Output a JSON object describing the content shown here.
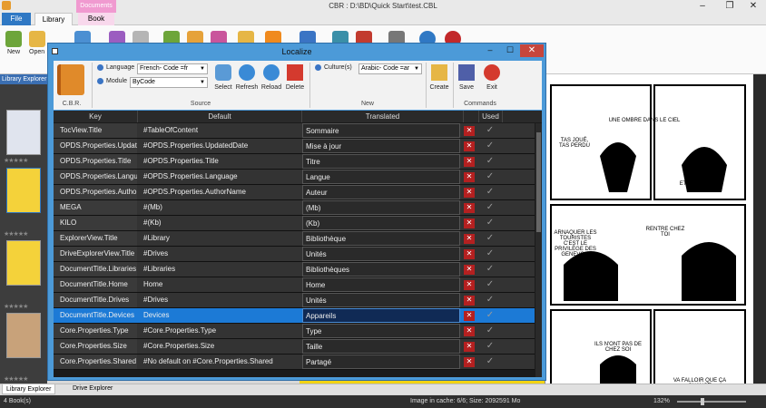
{
  "window": {
    "title": "CBR : D:\\BD\\Quick Start\\test.CBL",
    "context_tab": "Documents"
  },
  "ribbon": {
    "tabs": [
      "File",
      "Library",
      "Book"
    ],
    "buttons": [
      "New",
      "Open"
    ]
  },
  "library_explorer": {
    "title": "Library Explorer"
  },
  "dialog": {
    "title": "Localize",
    "cbr_group_label": "C.B.R.",
    "language_label": "Language",
    "language_value": "French- Code =fr",
    "module_label": "Module",
    "module_value": "ByCode",
    "select_label": "Select",
    "refresh_label": "Refresh",
    "reload_label": "Reload",
    "delete_label": "Delete",
    "source_group_label": "Source",
    "culture_label": "Culture(s)",
    "culture_value": "Arabic- Code =ar",
    "new_group_label": "New",
    "create_label": "Create",
    "save_label": "Save",
    "exit_label": "Exit",
    "commands_group_label": "Commands",
    "columns": [
      "Key",
      "Default",
      "Translated",
      "Used"
    ],
    "rows": [
      {
        "key": "TocView.Title",
        "default": "#TableOfContent",
        "translated": "Sommaire"
      },
      {
        "key": "OPDS.Properties.UpdatedDate",
        "default": "#OPDS.Properties.UpdatedDate",
        "translated": "Mise à jour"
      },
      {
        "key": "OPDS.Properties.Title",
        "default": "#OPDS.Properties.Title",
        "translated": "Titre"
      },
      {
        "key": "OPDS.Properties.Language",
        "default": "#OPDS.Properties.Language",
        "translated": "Langue"
      },
      {
        "key": "OPDS.Properties.AuthorName",
        "default": "#OPDS.Properties.AuthorName",
        "translated": "Auteur"
      },
      {
        "key": "MEGA",
        "default": "#(Mb)",
        "translated": "(Mb)"
      },
      {
        "key": "KILO",
        "default": "#(Kb)",
        "translated": "(Kb)"
      },
      {
        "key": "ExplorerView.Title",
        "default": "#Library",
        "translated": "Bibliothèque"
      },
      {
        "key": "DriveExplorerView.Title",
        "default": "#Drives",
        "translated": "Unités"
      },
      {
        "key": "DocumentTitle.Libraries",
        "default": "#Libraries",
        "translated": "Bibliothèques"
      },
      {
        "key": "DocumentTitle.Home",
        "default": "Home",
        "translated": "Home"
      },
      {
        "key": "DocumentTitle.Drives",
        "default": "#Drives",
        "translated": "Unités"
      },
      {
        "key": "DocumentTitle.Devices",
        "default": "Devices",
        "translated": "Appareils",
        "selected": true
      },
      {
        "key": "Core.Properties.Type",
        "default": "#Core.Properties.Type",
        "translated": "Type"
      },
      {
        "key": "Core.Properties.Size",
        "default": "#Core.Properties.Size",
        "translated": "Taille"
      },
      {
        "key": "Core.Properties.Shared",
        "default": "#No default on #Core.Properties.Shared",
        "translated": "Partagé"
      }
    ]
  },
  "bottom_tabs": [
    "Library Explorer",
    "Drive Explorer"
  ],
  "status": {
    "books": "4 Book(s)",
    "cache": "Image in cache: 6/6; Size: 2092591 Mo",
    "zoom": "132%"
  },
  "comic_text": [
    "UNE OMBRE DANS LE CIEL",
    "TAS JOUÉ, TAS PERDU",
    "ET SOUDAIN",
    "ARNAQUER LES TOURISTES C'EST LE PRIVILÈGE DES GENEVOIS",
    "RENTRE CHEZ TOI",
    "ILS N'ONT PAS DE CHEZ SOI",
    "VA FALLOIR QUE ÇA CHANGE"
  ],
  "colors": {
    "accent": "#4c9ad8",
    "selected_row": "#1c7ad6",
    "delete_red": "#b42020"
  }
}
